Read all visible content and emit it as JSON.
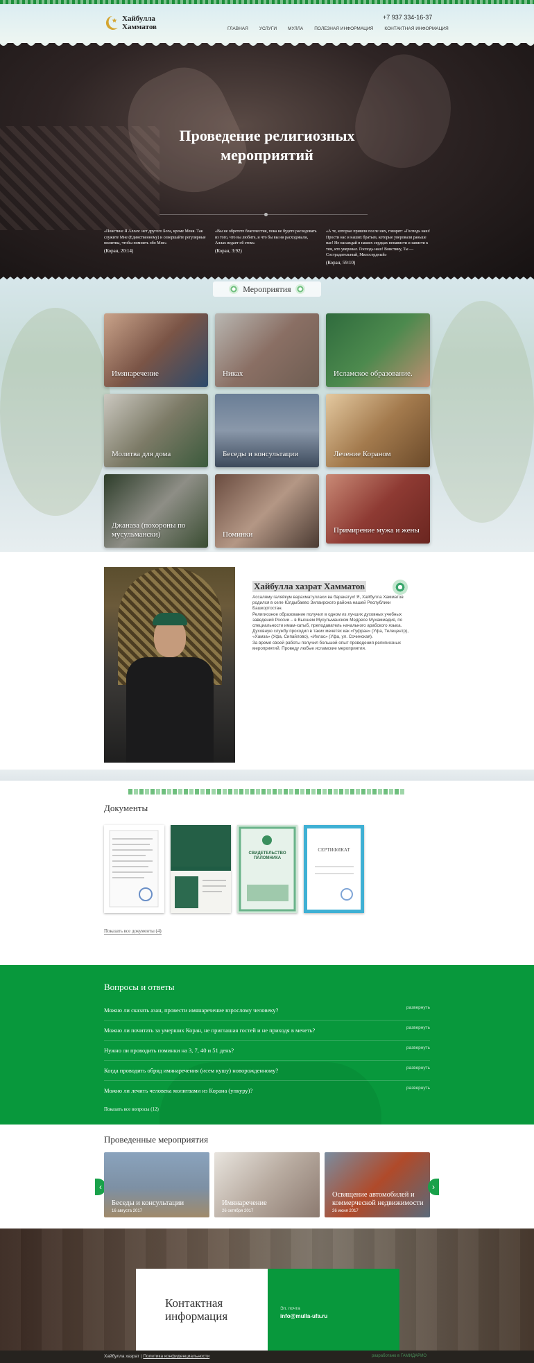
{
  "header": {
    "logo_line1": "Хайбулла",
    "logo_line2": "Хамматов",
    "phone": "+7 937 334-16-37",
    "nav": [
      "ГЛАВНАЯ",
      "УСЛУГИ",
      "МУЛЛА",
      "ПОЛЕЗНАЯ ИНФОРМАЦИЯ",
      "КОНТАКТНАЯ ИНФОРМАЦИЯ"
    ]
  },
  "hero": {
    "title_line1": "Проведение религиозных",
    "title_line2": "мероприятий",
    "quotes": [
      {
        "text": "«Поистине Я Аллах: нет другого Бога, кроме Меня. Так служите Мне (Единственному) и совершайте регулярные молитвы, чтобы помнить обо Мне»",
        "source": "(Коран, 20:14)"
      },
      {
        "text": "«Вы не обретете благочестия, пока не будете расходовать из того, что вы любите, и что бы вы ни расходовали, Аллах ведает об этом»",
        "source": "(Коран, 3:92)"
      },
      {
        "text": "«А те, которые пришли после них, говорят: «Господь наш! Прости нас и наших братьев, которые уверовали раньше нас! Не насаждай в наших сердцах ненависти и зависти к тем, кто уверовал. Господь наш! Воистину, Ты — Сострадательный, Милосердный»",
        "source": "(Коран, 59:10)"
      }
    ]
  },
  "events": {
    "heading": "Мероприятия",
    "tiles": [
      "Имянаречение",
      "Никах",
      "Исламское образование.",
      "Молитва для дома",
      "Беседы и консультации",
      "Лечение Кораном",
      "Джаназа (похороны по мусульмански)",
      "Поминки",
      "Примирение мужа и жены"
    ]
  },
  "about": {
    "title": "Хайбулла хазрат Хамматов",
    "paragraphs": [
      "Ассаляму галяйкум варахматуллахи ва баракатух! Я, Хайбулла Хамматов родился в селе Юлдыбаево Зилаирского района нашей Республики Башкортостан.",
      "Религиозное образование получил в одном из лучших духовных учебных заведений России – в Высшем Мусульманском Медресе Мухаммадия, по специальности имам-хатыб, преподаватель начального арабского языка. Духовную службу проходил в таких мечетях как «Гуфран» (Уфа, Телецентр), «Хамза» (Уфа, Сипайлово), «Ихлас» (Уфа, ул. Сочинская).",
      "За время своей работы получил большой опыт проведения религиозных мероприятий. Проведу любые исламские мероприятия."
    ]
  },
  "documents": {
    "heading": "Документы",
    "show_all": "Показать все документы (4)",
    "items": [
      "СВИДЕТЕЛЬСТВО ПАЛОМНИКА",
      "СЕРТИФИКАТ"
    ]
  },
  "faq": {
    "heading": "Вопросы и ответы",
    "toggle_label": "развернуть",
    "questions": [
      "Можно ли сказать азан, провести имянаречение взрослому человеку?",
      "Можно ли почитать за умерших Коран, не приглашая гостей и не приходя в мечеть?",
      "Нужно ли проводить поминки на 3, 7, 40 и 51 день?",
      "Когда проводить обряд имянаречения (исем кушу) новорожденному?",
      "Можно ли лечить человека молитвами из Корана (упкуру)?"
    ],
    "show_all": "Показать все вопросы (12)"
  },
  "past_events": {
    "heading": "Проведенные мероприятия",
    "items": [
      {
        "title": "Беседы и консультации",
        "date": "16 августа 2017"
      },
      {
        "title": "Имянаречение",
        "date": "26 октября 2017"
      },
      {
        "title": "Освящение автомобилей и коммерческой недвижимости",
        "date": "26 июня 2017"
      }
    ]
  },
  "contact": {
    "title_line1": "Контактная",
    "title_line2": "информация",
    "email_label": "Эл. почта",
    "email": "info@mulla-ufa.ru"
  },
  "footer": {
    "name": "Хайбулла хазрат",
    "privacy": "Политика конфиденциальности",
    "dev": "разработано в ГАМИДАРИО"
  },
  "colors": {
    "brand_green": "#08983c",
    "dark": "#1f1a1a"
  }
}
